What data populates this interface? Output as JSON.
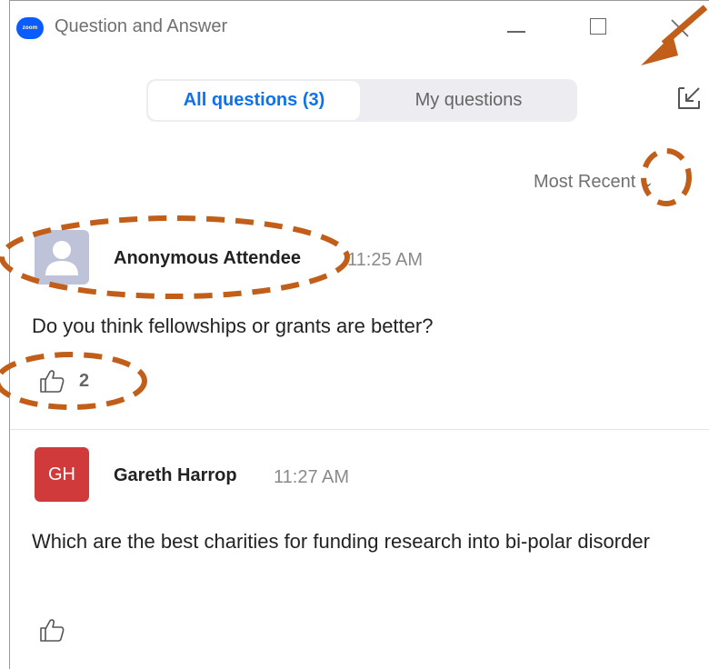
{
  "window": {
    "title": "Question and Answer",
    "logo_text": "zoom",
    "controls": [
      "minimize-icon",
      "maximize-icon",
      "close-icon"
    ]
  },
  "tabs": {
    "all_questions": "All questions (3)",
    "my_questions": "My questions"
  },
  "sort": {
    "label": "Most Recent",
    "icon": "chevron-down-icon"
  },
  "questions": [
    {
      "author": "Anonymous Attendee",
      "time": "11:25 AM",
      "text": "Do you think fellowships or grants are better?",
      "likes": "2",
      "avatar": "user-silhouette-icon"
    },
    {
      "author": "Gareth Harrop",
      "initials": "GH",
      "time": "11:27 AM",
      "text": "Which are the best charities for funding research into bi-polar disorder",
      "likes": ""
    }
  ],
  "colors": {
    "accent": "#0e72ed",
    "annotation": "#c15f1a",
    "avatar_gh": "#d13a3a",
    "avatar_anon": "#bfc3d9"
  }
}
